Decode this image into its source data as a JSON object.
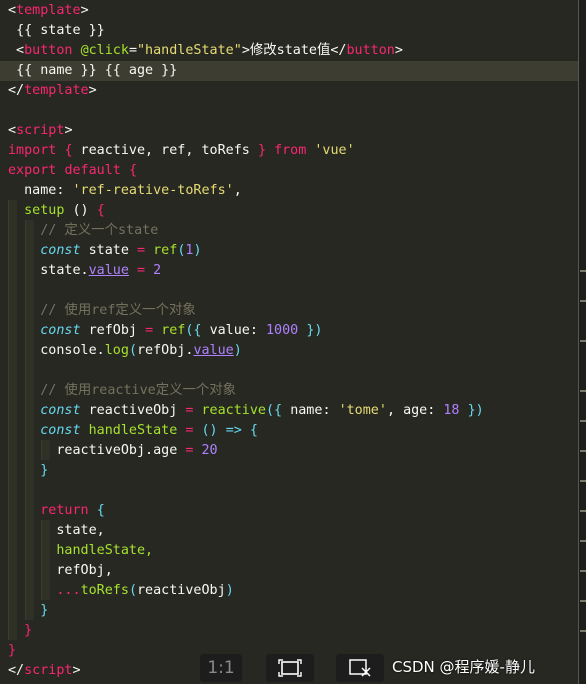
{
  "code": {
    "l1": "template",
    "l2": "{{ state }}",
    "l3_tag": "button",
    "l3_attr": "@click",
    "l3_str": "\"handleState\"",
    "l3_text": "修改state值",
    "l4": "{{ name }} {{ age }}",
    "l7_tag": "script",
    "l8_import": "import",
    "l8_names": " reactive, ref, toRefs ",
    "l8_from": "from",
    "l8_src": "'vue'",
    "l9_export": "export",
    "l9_default": "default",
    "l10_key": "name",
    "l10_val": "'ref-reative-toRefs'",
    "l11_fn": "setup",
    "l12_cm": "// 定义一个state",
    "l13_const": "const",
    "l13_var": "state",
    "l13_ref": "ref",
    "l13_num": "1",
    "l14_obj": "state.",
    "l14_prop": "value",
    "l14_num": "2",
    "l16_cm": "// 使用ref定义一个对象",
    "l17_const": "const",
    "l17_var": "refObj",
    "l17_ref": "ref",
    "l17_key": "value",
    "l17_num": "1000",
    "l18_console": "console.",
    "l18_log": "log",
    "l18_arg": "refObj.",
    "l18_prop": "value",
    "l20_cm": "// 使用reactive定义一个对象",
    "l21_const": "const",
    "l21_var": "reactiveObj",
    "l21_fn": "reactive",
    "l21_key1": "name",
    "l21_str": "'tome'",
    "l21_key2": "age",
    "l21_num": "18",
    "l22_const": "const",
    "l22_var": "handleState",
    "l23_obj": "reactiveObj.age",
    "l23_num": "20",
    "l26_return": "return",
    "l27": "state,",
    "l28": "handleState,",
    "l29": "refObj,",
    "l30_spread": "...",
    "l30_fn": "toRefs",
    "l30_arg": "reactiveObj",
    "l33_tag": "script"
  },
  "toolbar": {
    "zoom_label": "1:1"
  },
  "watermark": "CSDN @程序媛-静儿",
  "colors": {
    "background": "#272822",
    "tag": "#f92672",
    "function": "#a6e22e",
    "string": "#e6db74",
    "number": "#ae81ff",
    "comment": "#75715e"
  }
}
